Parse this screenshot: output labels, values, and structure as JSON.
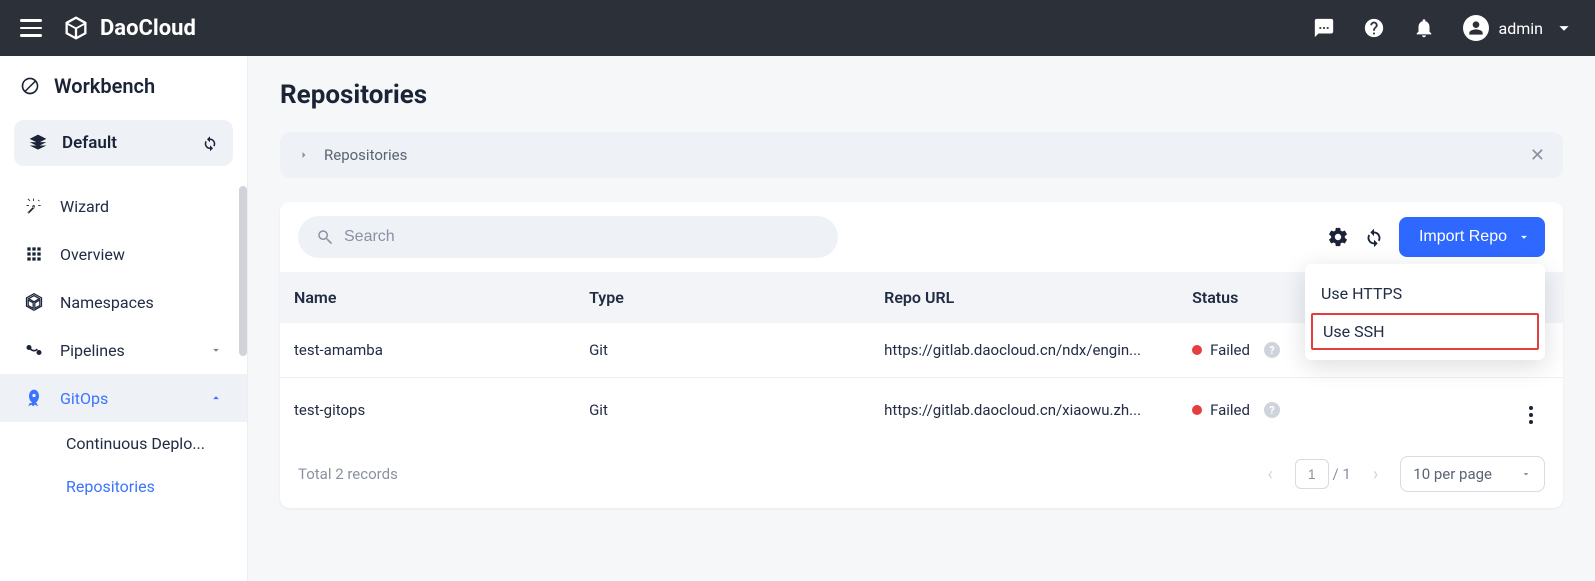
{
  "topbar": {
    "brand": "DaoCloud",
    "user": "admin"
  },
  "sidebar": {
    "section_title": "Workbench",
    "workspace_label": "Default",
    "items": [
      {
        "label": "Wizard"
      },
      {
        "label": "Overview"
      },
      {
        "label": "Namespaces"
      },
      {
        "label": "Pipelines"
      },
      {
        "label": "GitOps"
      }
    ],
    "gitops_sub": [
      {
        "label": "Continuous Deplo..."
      },
      {
        "label": "Repositories"
      }
    ]
  },
  "page": {
    "title": "Repositories",
    "breadcrumb": "Repositories"
  },
  "toolbar": {
    "search_placeholder": "Search",
    "import_label": "Import Repo",
    "dropdown": {
      "https": "Use HTTPS",
      "ssh": "Use SSH"
    }
  },
  "table": {
    "headers": {
      "name": "Name",
      "type": "Type",
      "url": "Repo URL",
      "status": "Status"
    },
    "rows": [
      {
        "name": "test-amamba",
        "type": "Git",
        "url": "https://gitlab.daocloud.cn/ndx/engin...",
        "status": "Failed"
      },
      {
        "name": "test-gitops",
        "type": "Git",
        "url": "https://gitlab.daocloud.cn/xiaowu.zh...",
        "status": "Failed"
      }
    ]
  },
  "footer": {
    "total": "Total 2 records",
    "page_current": "1",
    "page_total": "/ 1",
    "per_page": "10 per page"
  }
}
